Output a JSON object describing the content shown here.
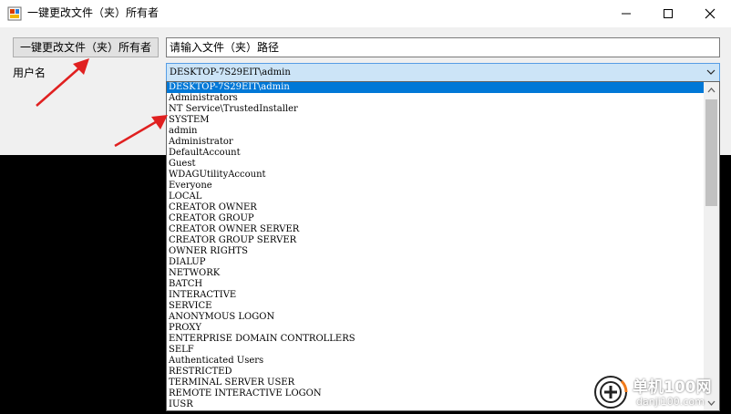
{
  "window": {
    "title": "一键更改文件（夹）所有者",
    "controls": {
      "minimize": "minimize-icon",
      "maximize": "maximize-icon",
      "close": "close-icon"
    }
  },
  "toolbar": {
    "action_button_label": "一键更改文件（夹）所有者",
    "path_input_value": "请输入文件（夹）路径"
  },
  "user": {
    "label": "用户名",
    "selected_value": "DESKTOP-7S29EIT\\admin"
  },
  "dropdown": {
    "items": [
      "DESKTOP-7S29EIT\\admin",
      "Administrators",
      "NT Service\\TrustedInstaller",
      "SYSTEM",
      "admin",
      "Administrator",
      "DefaultAccount",
      "Guest",
      "WDAGUtilityAccount",
      "Everyone",
      "LOCAL",
      "CREATOR OWNER",
      "CREATOR GROUP",
      "CREATOR OWNER SERVER",
      "CREATOR GROUP SERVER",
      "OWNER RIGHTS",
      "DIALUP",
      "NETWORK",
      "BATCH",
      "INTERACTIVE",
      "SERVICE",
      "ANONYMOUS LOGON",
      "PROXY",
      "ENTERPRISE DOMAIN CONTROLLERS",
      "SELF",
      "Authenticated Users",
      "RESTRICTED",
      "TERMINAL SERVER USER",
      "REMOTE INTERACTIVE LOGON",
      "IUSR"
    ],
    "selected_index": 0
  },
  "watermark": {
    "name": "单机100网",
    "url": "danji100.com"
  },
  "colors": {
    "selection": "#0078d7",
    "combo_background": "#cce4f7",
    "annotation_arrow": "#e02020",
    "watermark_orange": "#f07a1a"
  }
}
